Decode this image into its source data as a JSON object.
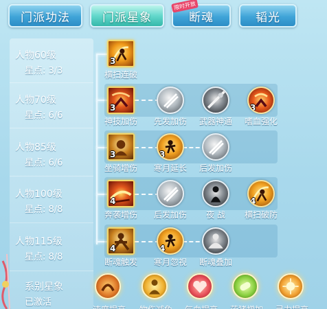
{
  "tabs": [
    {
      "label": "门派功法",
      "active": false
    },
    {
      "label": "门派星象",
      "active": true
    },
    {
      "label": "断魂",
      "active": false,
      "badge": "限时开放"
    },
    {
      "label": "韬光",
      "active": false
    }
  ],
  "rows": [
    {
      "level": "人物60级",
      "stars_text": "星点: 3/3",
      "skills": [
        {
          "name": "横扫连破",
          "points": "3",
          "icon": "sweep-strike-icon"
        }
      ]
    },
    {
      "level": "人物70级",
      "stars_text": "星点: 6/6",
      "skills": [
        {
          "name": "神技加伤",
          "points": "3",
          "icon": "divine-skill-icon"
        },
        {
          "name": "先发加伤",
          "points": "",
          "icon": "first-strike-icon"
        },
        {
          "name": "武器神通",
          "points": "",
          "icon": "weapon-mastery-icon"
        },
        {
          "name": "嗜血强化",
          "points": "3",
          "icon": "bloodthirst-icon"
        }
      ]
    },
    {
      "level": "人物85级",
      "stars_text": "星点: 6/6",
      "skills": [
        {
          "name": "坐骑增伤",
          "points": "3",
          "icon": "mount-damage-icon"
        },
        {
          "name": "寒月延长",
          "points": "3",
          "icon": "cold-moon-icon"
        },
        {
          "name": "后发加伤",
          "points": "",
          "icon": "late-strike-icon"
        }
      ]
    },
    {
      "level": "人物100级",
      "stars_text": "星点: 8/8",
      "skills": [
        {
          "name": "奔袭增伤",
          "points": "4",
          "icon": "charge-damage-icon"
        },
        {
          "name": "后发加伤",
          "points": "",
          "icon": "late-strike-icon"
        },
        {
          "name": "夜 战",
          "points": "",
          "icon": "night-battle-icon"
        },
        {
          "name": "横扫破防",
          "points": "4",
          "icon": "sweep-break-icon"
        }
      ]
    },
    {
      "level": "人物115级",
      "stars_text": "星点: 8/8",
      "skills": [
        {
          "name": "断魂触发",
          "points": "4",
          "icon": "soul-trigger-icon"
        },
        {
          "name": "寒月忽视",
          "points": "4",
          "icon": "cold-moon-ignore-icon"
        },
        {
          "name": "断魂叠加",
          "points": "",
          "icon": "soul-stack-icon"
        }
      ]
    }
  ],
  "series": {
    "title": "系别星象",
    "status": "已激活",
    "items": [
      {
        "name": "速度提高",
        "color": "#e07a2a"
      },
      {
        "name": "物伤减免",
        "color": "#f0b030"
      },
      {
        "name": "气血提高",
        "color": "#e8505a"
      },
      {
        "name": "药猪增加",
        "color": "#8ad040"
      },
      {
        "name": "灵力提高",
        "color": "#f2a030"
      }
    ]
  }
}
